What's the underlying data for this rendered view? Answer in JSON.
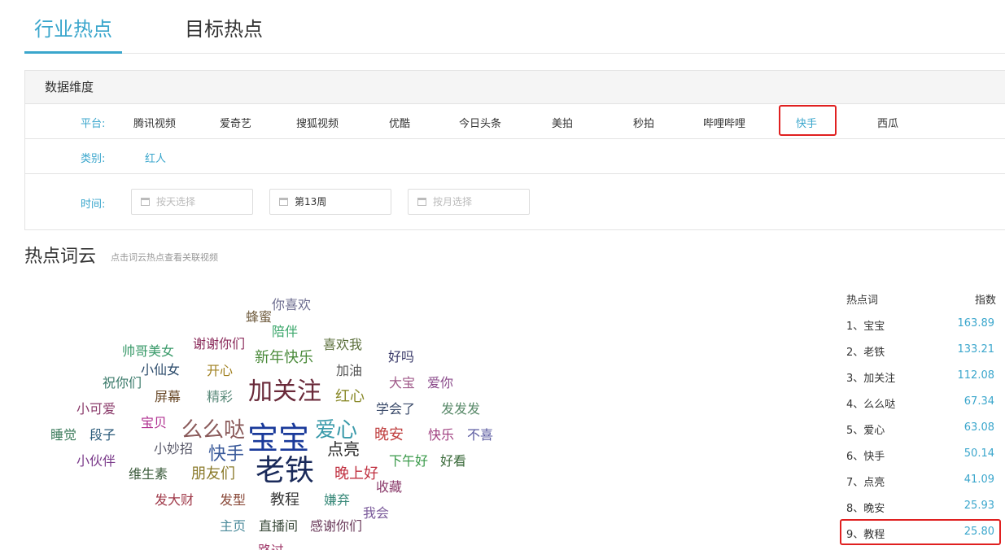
{
  "tabs": [
    {
      "label": "行业热点",
      "active": true
    },
    {
      "label": "目标热点",
      "active": false
    }
  ],
  "filter": {
    "title": "数据维度",
    "platform_label": "平台:",
    "platforms": [
      "腾讯视频",
      "爱奇艺",
      "搜狐视频",
      "优酷",
      "今日头条",
      "美拍",
      "秒拍",
      "哔哩哔哩",
      "快手",
      "西瓜"
    ],
    "selected_platform": "快手",
    "category_label": "类别:",
    "category_value": "红人",
    "time_label": "时间:",
    "day_placeholder": "按天选择",
    "week_value": "第13周",
    "month_placeholder": "按月选择"
  },
  "cloud": {
    "title": "热点词云",
    "subtitle": "点击词云热点查看关联视频",
    "words": [
      {
        "text": "你喜欢",
        "color": "#6b6b8e"
      },
      {
        "text": "蜂蜜",
        "color": "#6e5a3c"
      },
      {
        "text": "陪伴",
        "color": "#3aa66a"
      },
      {
        "text": "帅哥美女",
        "color": "#3a9a6a"
      },
      {
        "text": "谢谢你们",
        "color": "#8a2a5a"
      },
      {
        "text": "喜欢我",
        "color": "#5a6e3a"
      },
      {
        "text": "新年快乐",
        "color": "#4a8a3a"
      },
      {
        "text": "好吗",
        "color": "#3a3a6a"
      },
      {
        "text": "小仙女",
        "color": "#2a4a6a"
      },
      {
        "text": "开心",
        "color": "#a08020"
      },
      {
        "text": "加油",
        "color": "#555555"
      },
      {
        "text": "祝你们",
        "color": "#3a7a6a"
      },
      {
        "text": "加关注",
        "color": "#6a2a3a"
      },
      {
        "text": "大宝",
        "color": "#a05a8a"
      },
      {
        "text": "爱你",
        "color": "#8a4a8a"
      },
      {
        "text": "屏幕",
        "color": "#6a4a2a"
      },
      {
        "text": "精彩",
        "color": "#5a8a7a"
      },
      {
        "text": "红心",
        "color": "#8a8a2a"
      },
      {
        "text": "小可爱",
        "color": "#8a3a6a"
      },
      {
        "text": "学会了",
        "color": "#3a4a6a"
      },
      {
        "text": "发发发",
        "color": "#5a8a6a"
      },
      {
        "text": "宝贝",
        "color": "#b03090"
      },
      {
        "text": "么么哒",
        "color": "#8a5a5a"
      },
      {
        "text": "爱心",
        "color": "#3a9aaa"
      },
      {
        "text": "睡觉",
        "color": "#3a7a5a"
      },
      {
        "text": "段子",
        "color": "#2a5a7a"
      },
      {
        "text": "宝宝",
        "color": "#1a3a9a"
      },
      {
        "text": "晚安",
        "color": "#c04040"
      },
      {
        "text": "快乐",
        "color": "#a04080"
      },
      {
        "text": "不喜",
        "color": "#5a5aa0"
      },
      {
        "text": "小妙招",
        "color": "#5a5a6a"
      },
      {
        "text": "点亮",
        "color": "#2a2a2a"
      },
      {
        "text": "快手",
        "color": "#3a5a9a"
      },
      {
        "text": "小伙伴",
        "color": "#7a3a8a"
      },
      {
        "text": "下午好",
        "color": "#3a9a4a"
      },
      {
        "text": "好看",
        "color": "#3a6a3a"
      },
      {
        "text": "维生素",
        "color": "#3a5a3a"
      },
      {
        "text": "朋友们",
        "color": "#8a7a2a"
      },
      {
        "text": "老铁",
        "color": "#1a2a5a"
      },
      {
        "text": "晚上好",
        "color": "#c03040"
      },
      {
        "text": "收藏",
        "color": "#8a3a6a"
      },
      {
        "text": "发大财",
        "color": "#a03a4a"
      },
      {
        "text": "发型",
        "color": "#8a4a3a"
      },
      {
        "text": "教程",
        "color": "#3a3a3a"
      },
      {
        "text": "嫌弃",
        "color": "#3a8a7a"
      },
      {
        "text": "我会",
        "color": "#7a5a9a"
      },
      {
        "text": "主页",
        "color": "#4a8a9a"
      },
      {
        "text": "直播间",
        "color": "#3a4a3a"
      },
      {
        "text": "感谢你们",
        "color": "#6a3a5a"
      },
      {
        "text": "路过",
        "color": "#a03a6a"
      }
    ]
  },
  "ranking": {
    "head_word": "热点词",
    "head_index": "指数",
    "items": [
      {
        "name": "1、宝宝",
        "value": "163.89"
      },
      {
        "name": "2、老铁",
        "value": "133.21"
      },
      {
        "name": "3、加关注",
        "value": "112.08"
      },
      {
        "name": "4、么么哒",
        "value": "67.34"
      },
      {
        "name": "5、爱心",
        "value": "63.08"
      },
      {
        "name": "6、快手",
        "value": "50.14"
      },
      {
        "name": "7、点亮",
        "value": "41.09"
      },
      {
        "name": "8、晚安",
        "value": "25.93"
      },
      {
        "name": "9、教程",
        "value": "25.80"
      }
    ],
    "boxed_index": 8
  }
}
